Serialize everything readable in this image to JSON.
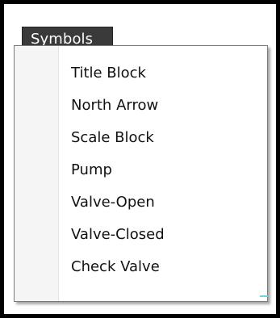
{
  "menu": {
    "title": "Symbols",
    "items": [
      {
        "label": "Title Block"
      },
      {
        "label": "North Arrow"
      },
      {
        "label": "Scale Block"
      },
      {
        "label": "Pump"
      },
      {
        "label": "Valve-Open"
      },
      {
        "label": "Valve-Closed"
      },
      {
        "label": "Check Valve"
      }
    ]
  },
  "colors": {
    "menu_title_background": "#3a3a3a",
    "menu_title_text": "#ffffff",
    "menu_background": "#ffffff",
    "icon_gutter": "#f5f5f5",
    "frame_border": "#000000"
  }
}
